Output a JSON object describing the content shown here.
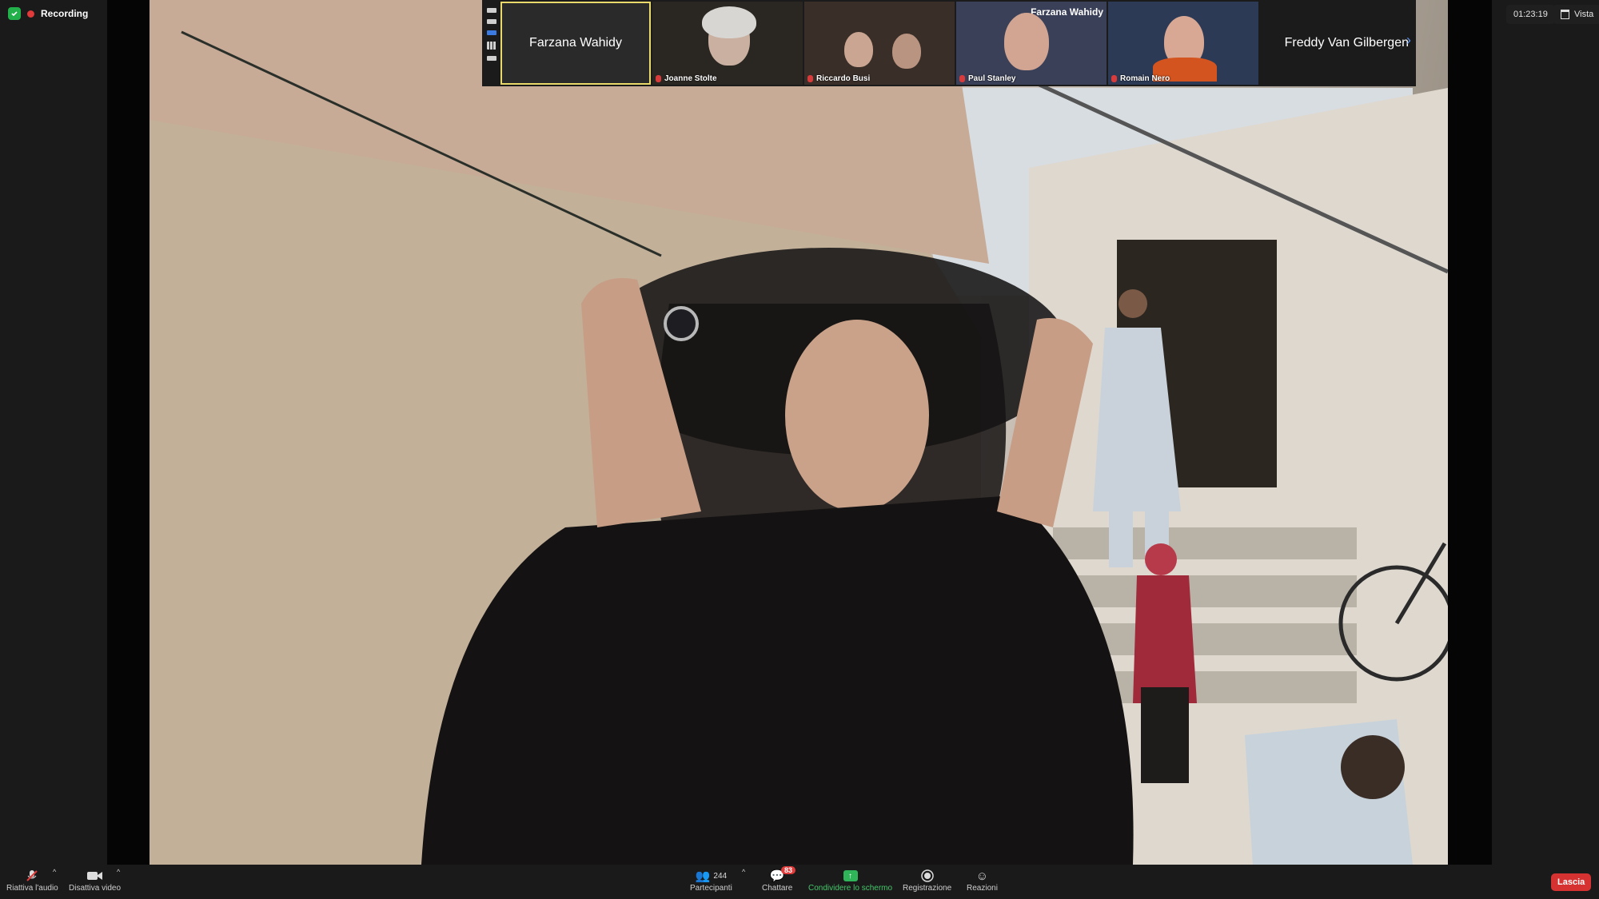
{
  "recording": {
    "label": "Recording"
  },
  "top_right": {
    "timer": "01:23:19",
    "view_label": "Vista"
  },
  "gallery": {
    "featured": "Farzana Wahidy",
    "tiles": [
      {
        "name": "Joanne Stolte"
      },
      {
        "name": "Riccardo Busi"
      },
      {
        "name": "Paul Stanley",
        "banner": "Farzana Wahidy"
      },
      {
        "name": "Romain Nero"
      }
    ],
    "last": "Freddy Van Gilbergen"
  },
  "toolbar": {
    "unmute": "Riattiva l'audio",
    "video": "Disattiva video",
    "participants": "Partecipanti",
    "participants_count": "244",
    "chat": "Chattare",
    "chat_badge": "83",
    "share": "Condividere lo schermo",
    "record": "Registrazione",
    "reactions": "Reazioni",
    "leave": "Lascia"
  },
  "colors": {
    "accent": "#3b7ae0",
    "share": "#2fb45a",
    "leave": "#d63232",
    "featured_border": "#e9d86a"
  },
  "icons": [
    "shield-icon",
    "record-dot-icon",
    "mic-off-icon",
    "video-icon",
    "participants-icon",
    "chat-icon",
    "share-screen-icon",
    "record-icon",
    "reactions-icon",
    "chevron-right-icon"
  ]
}
